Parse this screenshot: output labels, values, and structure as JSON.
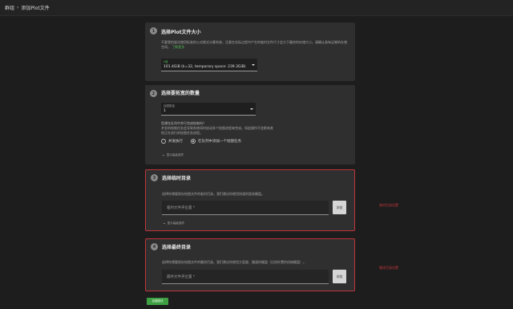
{
  "breadcrumb": {
    "parent": "群组",
    "separator": "›",
    "current": "添加Plot文件"
  },
  "steps": [
    {
      "number": "1",
      "title": "选择Plot文件大小",
      "description": "不要害怕尝试使用标准的公式格式计算系统，注意在实际过程中产生的临时文件尺寸会大于最终的存储大小。请确认具有足够的存储空间。",
      "link": "了解更多",
      "select_label": "k值",
      "select_value": "101.4GiB (k=32, temporary space: 239.3GiB)"
    },
    {
      "number": "2",
      "title": "选择要拓宽的数量",
      "select_label": "绘图数量",
      "select_value": "1",
      "question": "您想在队列中并行完成绘制吗？",
      "question_detail": "并发的绘制任务会导致系统同时启动多个绘图进程来完成。如此操作不会影响其他正在进行的绘图任务进程。",
      "radio_options": [
        "并发执行",
        "在队列中添加一个绘图任务"
      ],
      "radio_selected": 1,
      "toggle_label": "显示高级选项"
    },
    {
      "number": "3",
      "title": "选择临时目录",
      "description": "选择你想要保存绘图文件的临时目录。我们建议你使用快速的固态硬盘。",
      "placeholder": "临时文件夹位置 *",
      "browse_label": "浏览",
      "toggle_label": "显示高级选项"
    },
    {
      "number": "4",
      "title": "选择最终目录",
      "description": "选择你想要保存绘图文件的最终目录。我们建议你使用大容量、慢速的硬盘（比如外置的机械硬盘）。",
      "placeholder": "最终文件夹位置 *",
      "browse_label": "浏览"
    }
  ],
  "annotations": [
    "临时目录设置",
    "最终目录设置"
  ],
  "create_button": "创建图块",
  "colors": {
    "accent": "#3ea043",
    "highlight": "#c0353b",
    "card": "#2f2f2f",
    "background": "#1d1d1d"
  }
}
